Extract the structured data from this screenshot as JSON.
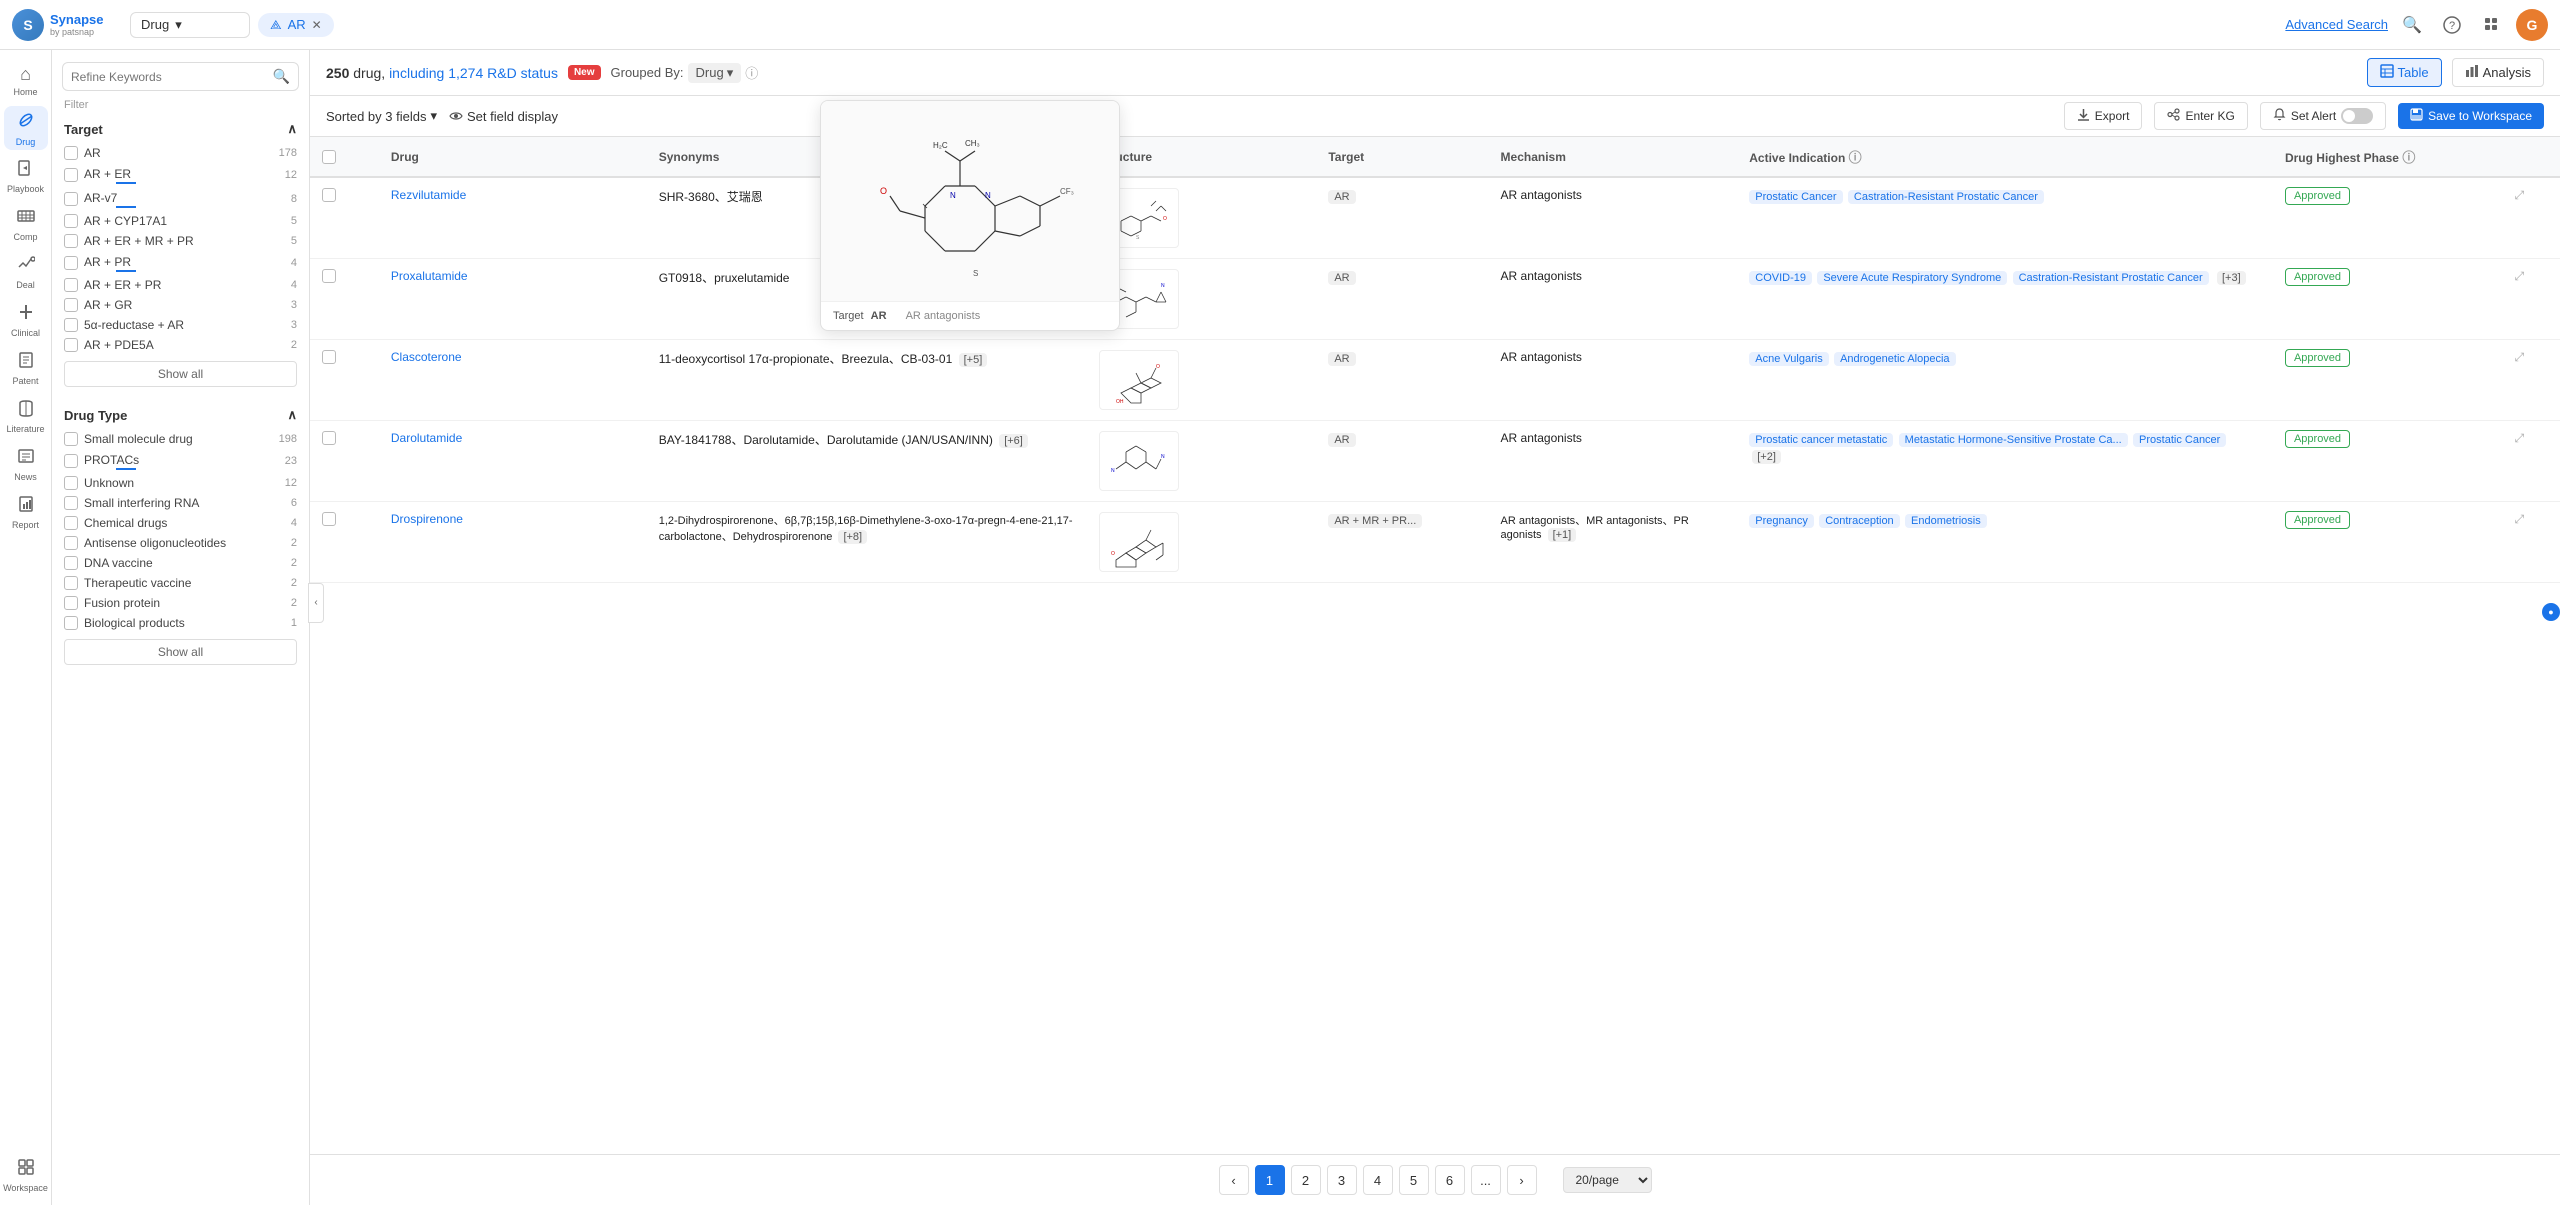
{
  "app": {
    "logo_letter": "S",
    "logo_name": "Synapse",
    "logo_sub": "by patsnap"
  },
  "topnav": {
    "search_type": "Drug",
    "search_type_arrow": "▾",
    "tab_label": "AR",
    "tab_close": "✕",
    "advanced_search": "Advanced Search",
    "search_icon": "🔍",
    "help_icon": "?",
    "apps_icon": "⠿",
    "user_initial": "G"
  },
  "sidebar": {
    "items": [
      {
        "id": "home",
        "icon": "⌂",
        "label": "Home"
      },
      {
        "id": "drug",
        "icon": "💊",
        "label": "Drug",
        "active": true
      },
      {
        "id": "playbook",
        "icon": "▶",
        "label": "Playbook"
      },
      {
        "id": "comp",
        "icon": "≋",
        "label": "Comp"
      },
      {
        "id": "deal",
        "icon": "🤝",
        "label": "Deal"
      },
      {
        "id": "clinical",
        "icon": "🏥",
        "label": "Clinical"
      },
      {
        "id": "patent",
        "icon": "📄",
        "label": "Patent"
      },
      {
        "id": "literature",
        "icon": "📚",
        "label": "Literature"
      },
      {
        "id": "news",
        "icon": "📰",
        "label": "News"
      },
      {
        "id": "report",
        "icon": "📊",
        "label": "Report"
      },
      {
        "id": "workspace",
        "icon": "🗂",
        "label": "Workspace"
      }
    ]
  },
  "filter": {
    "search_placeholder": "Refine Keywords",
    "filter_label": "Filter",
    "sections": [
      {
        "id": "target",
        "label": "Target",
        "expanded": true,
        "items": [
          {
            "id": "ar",
            "label": "AR",
            "count": 178,
            "underline": true
          },
          {
            "id": "ar_er",
            "label": "AR + ER",
            "count": 12,
            "underline": true
          },
          {
            "id": "ar_v7",
            "label": "AR-v7",
            "count": 8,
            "underline": true
          },
          {
            "id": "ar_cyp17a1",
            "label": "AR + CYP17A1",
            "count": 5
          },
          {
            "id": "ar_er_mr_pr",
            "label": "AR + ER + MR + PR",
            "count": 5
          },
          {
            "id": "ar_pr",
            "label": "AR + PR",
            "count": 4
          },
          {
            "id": "ar_er_pr",
            "label": "AR + ER + PR",
            "count": 4
          },
          {
            "id": "ar_gr",
            "label": "AR + GR",
            "count": 3
          },
          {
            "id": "5ar_ar",
            "label": "5α-reductase + AR",
            "count": 3
          },
          {
            "id": "ar_pde5a",
            "label": "AR + PDE5A",
            "count": 2
          }
        ],
        "show_all": true
      },
      {
        "id": "drug_type",
        "label": "Drug Type",
        "expanded": true,
        "items": [
          {
            "id": "small_mol",
            "label": "Small molecule drug",
            "count": 198
          },
          {
            "id": "protacs",
            "label": "PROTACs",
            "count": 23,
            "underline": true
          },
          {
            "id": "unknown",
            "label": "Unknown",
            "count": 12
          },
          {
            "id": "sirna",
            "label": "Small interfering RNA",
            "count": 6
          },
          {
            "id": "chemical",
            "label": "Chemical drugs",
            "count": 4
          },
          {
            "id": "antisense",
            "label": "Antisense oligonucleotides",
            "count": 2
          },
          {
            "id": "dna_vaccine",
            "label": "DNA vaccine",
            "count": 2
          },
          {
            "id": "therapeutic_vaccine",
            "label": "Therapeutic vaccine",
            "count": 2
          },
          {
            "id": "fusion_protein",
            "label": "Fusion protein",
            "count": 2
          },
          {
            "id": "biological",
            "label": "Biological products",
            "count": 1
          }
        ],
        "show_all": true
      }
    ]
  },
  "toolbar": {
    "result_count": "250",
    "result_type": "drug,",
    "result_link": "including 1,274 R&D status",
    "new_badge": "New",
    "grouped_by_label": "Grouped By:",
    "grouped_by_val": "Drug",
    "info_tooltip": "ℹ",
    "table_label": "Table",
    "analysis_label": "Analysis"
  },
  "sub_toolbar": {
    "sorted_by": "Sorted by 3 fields",
    "set_field_display": "Set field display",
    "eye_icon": "👁",
    "export_label": "Export",
    "enter_kg_label": "Enter KG",
    "set_alert_label": "Set Alert",
    "save_workspace_label": "Save to Workspace"
  },
  "table": {
    "columns": [
      {
        "id": "check",
        "label": ""
      },
      {
        "id": "drug",
        "label": "Drug"
      },
      {
        "id": "synonyms",
        "label": "Synonyms"
      },
      {
        "id": "structure",
        "label": "Structure"
      },
      {
        "id": "target",
        "label": "Target"
      },
      {
        "id": "mechanism",
        "label": "Mechanism"
      },
      {
        "id": "indication",
        "label": "Active Indication"
      },
      {
        "id": "phase",
        "label": "Drug Highest Phase"
      },
      {
        "id": "expand",
        "label": ""
      }
    ],
    "rows": [
      {
        "drug": "Rezvilutamide",
        "synonyms": "SHR-3680、艾瑞恩",
        "target": "AR",
        "mechanism": "AR antagonists",
        "indications": [
          "Prostatic Cancer",
          "Castration-Resistant Prostatic Cancer"
        ],
        "more_ind": 0,
        "phase": "Approved"
      },
      {
        "drug": "Proxalutamide",
        "synonyms": "GT0918、pruxelutamide",
        "target": "AR",
        "mechanism": "AR antagonists",
        "indications": [
          "COVID-19",
          "Severe Acute Respiratory Syndrome",
          "Castration-Resistant Prostatic Cancer"
        ],
        "more_ind": 3,
        "phase": "Approved"
      },
      {
        "drug": "Clascoterone",
        "synonyms": "11-deoxycortisol 17α-propionate、Breezula、CB-03-01",
        "more_syn": 5,
        "target": "AR",
        "mechanism": "AR antagonists",
        "indications": [
          "Acne Vulgaris",
          "Androgenetic Alopecia"
        ],
        "more_ind": 0,
        "phase": "Approved"
      },
      {
        "drug": "Darolutamide",
        "synonyms": "BAY-1841788、Darolutamide、Darolutamide (JAN/USAN/INN)",
        "more_syn": 6,
        "target": "AR",
        "mechanism": "AR antagonists",
        "indications": [
          "Prostatic cancer metastatic",
          "Metastatic Hormone-Sensitive Prostate Ca...",
          "Prostatic Cancer"
        ],
        "more_ind": 2,
        "phase": "Approved"
      },
      {
        "drug": "Drospirenone",
        "synonyms": "1,2-Dihydrospirorenone、6β,7β;15β,16β-Dimethylene-3-oxo-17α-pregn-4-ene-21,17-carbolactone、Dehydrospirorenone",
        "more_syn": 8,
        "target": "AR + MR + PR...",
        "mechanism": "AR antagonists、MR antagonists、PR agonists",
        "more_mech": 1,
        "indications": [
          "Pregnancy",
          "Contraception",
          "Endometriosis"
        ],
        "more_ind": 0,
        "phase": "Approved"
      }
    ]
  },
  "pagination": {
    "current_page": 1,
    "pages": [
      1,
      2,
      3,
      4,
      5,
      6
    ],
    "ellipsis": "...",
    "prev_icon": "‹",
    "next_icon": "›",
    "page_size": "20/page"
  },
  "structure_popup": {
    "target_label": "Target",
    "mechanism_label": "AR antagonists",
    "target_val": "AR"
  }
}
